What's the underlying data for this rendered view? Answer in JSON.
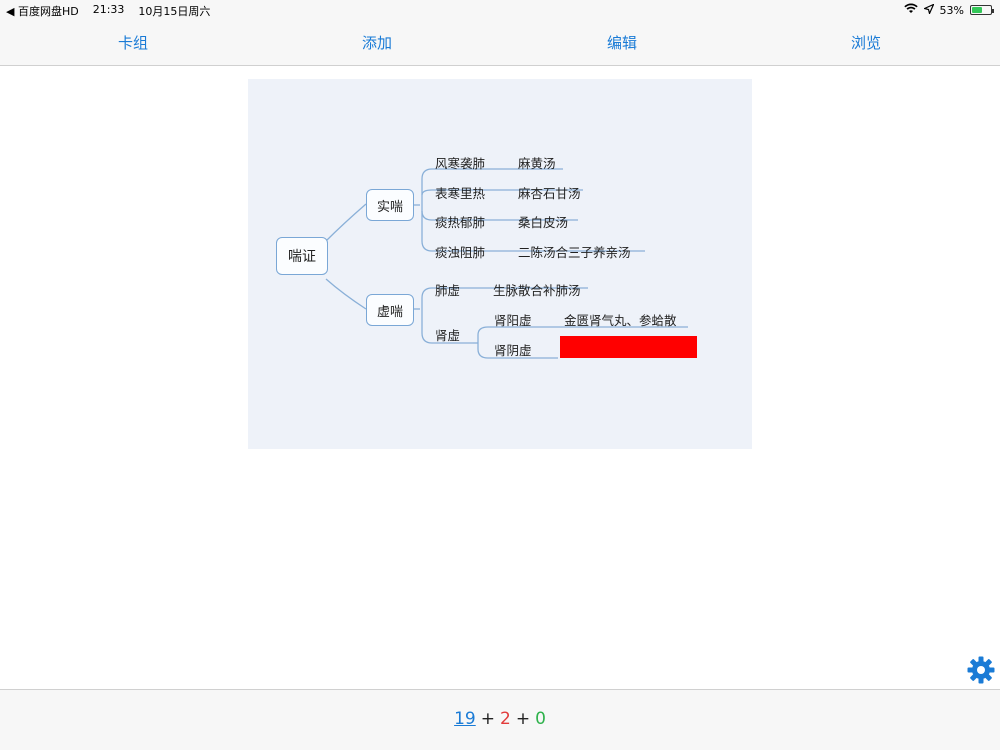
{
  "status_bar": {
    "back_app": "◀ 百度网盘HD",
    "time": "21:33",
    "date": "10月15日周六",
    "battery_text": "53%",
    "battery_level": 0.53
  },
  "nav": {
    "tabs": [
      "卡组",
      "添加",
      "编辑",
      "浏览"
    ]
  },
  "mindmap": {
    "root": "喘证",
    "branch_excess": "实喘",
    "branch_deficiency": "虚喘",
    "excess_items": [
      {
        "syndrome": "风寒袭肺",
        "formula": "麻黄汤"
      },
      {
        "syndrome": "表寒里热",
        "formula": "麻杏石甘汤"
      },
      {
        "syndrome": "痰热郁肺",
        "formula": "桑白皮汤"
      },
      {
        "syndrome": "痰浊阻肺",
        "formula": "二陈汤合三子养亲汤"
      }
    ],
    "lung_def": {
      "syndrome": "肺虚",
      "formula": "生脉散合补肺汤"
    },
    "kidney_def": {
      "label": "肾虚",
      "yang": {
        "syndrome": "肾阳虚",
        "formula": "金匮肾气丸、参蛤散"
      },
      "yin": {
        "syndrome": "肾阴虚"
      }
    }
  },
  "bottom": {
    "count_new": "19",
    "plus": "+",
    "count_learning": "2",
    "count_review": "0"
  },
  "colors": {
    "accent": "#1a7bd6",
    "redaction": "#ff0000"
  }
}
